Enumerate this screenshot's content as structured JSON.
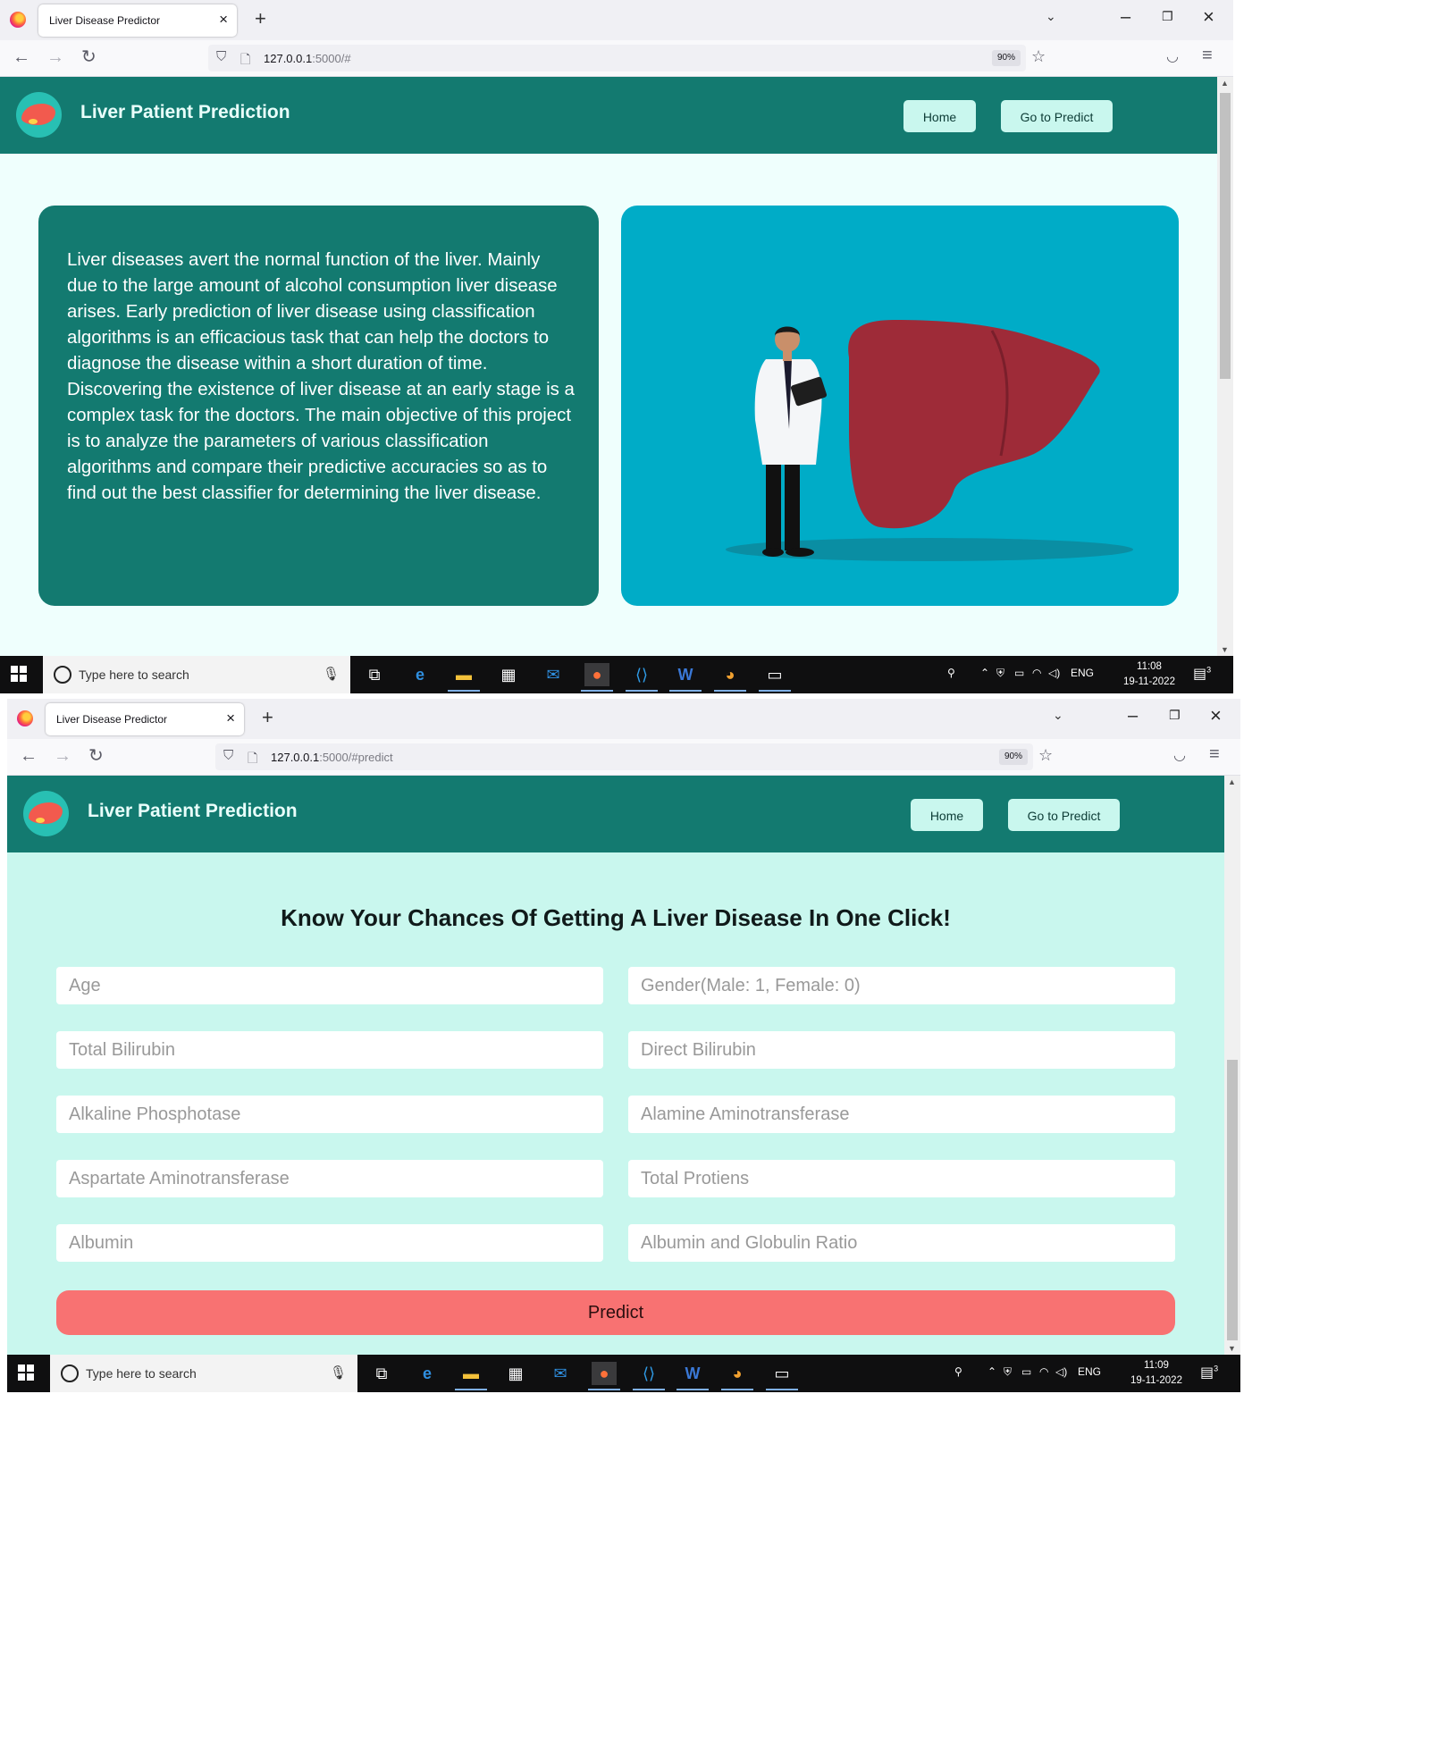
{
  "screen_home": {
    "tab_title": "Liver Disease Predictor",
    "url_host": "127.0.0.1",
    "url_rest": ":5000/#",
    "zoom": "90%",
    "brand": "Liver Patient Prediction",
    "nav_home": "Home",
    "nav_predict": "Go to Predict",
    "about_text": "Liver diseases avert the normal function of the liver. Mainly due to the large amount of alcohol consumption liver disease arises. Early prediction of liver disease using classification algorithms is an efficacious task that can help the doctors to diagnose the disease within a short duration of time. Discovering the existence of liver disease at an early stage is a complex task for the doctors. The main objective of this project is to analyze the parameters of various classification algorithms and compare their predictive accuracies so as to find out the best classifier for determining the liver disease.",
    "clock_time": "11:08",
    "clock_date": "19-11-2022"
  },
  "screen_predict": {
    "tab_title": "Liver Disease Predictor",
    "url_host": "127.0.0.1",
    "url_rest": ":5000/#predict",
    "zoom": "90%",
    "brand": "Liver Patient Prediction",
    "nav_home": "Home",
    "nav_predict": "Go to Predict",
    "heading": "Know Your Chances Of Getting A Liver Disease In One Click!",
    "fields": [
      {
        "placeholder": "Age",
        "value": ""
      },
      {
        "placeholder": "Gender(Male: 1, Female: 0)",
        "value": ""
      },
      {
        "placeholder": "Total Bilirubin",
        "value": ""
      },
      {
        "placeholder": "Direct Bilirubin",
        "value": ""
      },
      {
        "placeholder": "Alkaline Phosphotase",
        "value": ""
      },
      {
        "placeholder": "Alamine Aminotransferase",
        "value": ""
      },
      {
        "placeholder": "Aspartate Aminotransferase",
        "value": ""
      },
      {
        "placeholder": "Total Protiens",
        "value": ""
      },
      {
        "placeholder": "Albumin",
        "value": ""
      },
      {
        "placeholder": "Albumin and Globulin Ratio",
        "value": ""
      }
    ],
    "predict_label": "Predict",
    "clock_time": "11:09",
    "clock_date": "19-11-2022"
  },
  "taskbar": {
    "search_placeholder": "Type here to search",
    "language": "ENG",
    "notification_count": "3"
  },
  "colors": {
    "header": "#137a70",
    "home_bg": "#effffd",
    "predict_bg": "#c9f7ee",
    "nav_button": "#c9f7ee",
    "illustration_bg": "#00acc7",
    "predict_button": "#f87272"
  },
  "icons": [
    "firefox-icon",
    "back-icon",
    "forward-icon",
    "reload-icon",
    "shield-icon",
    "page-icon",
    "star-icon",
    "pocket-icon",
    "menu-icon",
    "liver-logo-icon",
    "windows-start-icon",
    "search-icon",
    "mic-icon",
    "task-view-icon",
    "edge-icon",
    "file-explorer-icon",
    "store-icon",
    "mail-icon",
    "vscode-icon",
    "word-icon",
    "paint-icon",
    "terminal-icon",
    "notification-icon"
  ]
}
